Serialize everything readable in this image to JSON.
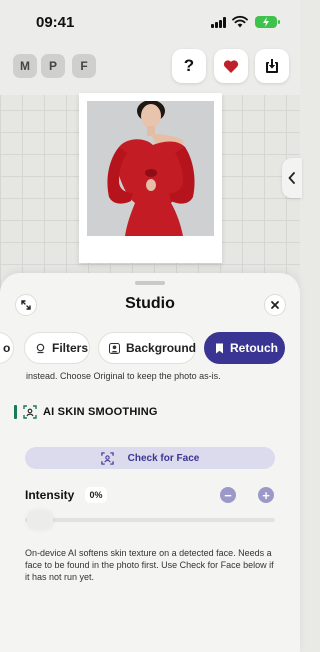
{
  "status_bar": {
    "time": "09:41"
  },
  "modes": [
    "M",
    "P",
    "F"
  ],
  "top_actions": {
    "help_label": "?"
  },
  "sheet": {
    "title": "Studio",
    "tabs": [
      {
        "label": "o",
        "icon": ""
      },
      {
        "label": "Filters",
        "icon": "filter-icon"
      },
      {
        "label": "Background",
        "icon": "person-icon"
      },
      {
        "label": "Retouch",
        "icon": "bookmark-icon",
        "active": true
      }
    ],
    "info_top": "instead. Choose Original to keep the photo as-is.",
    "section_title": "AI SKIN SMOOTHING",
    "check_face_label": "Check for Face",
    "intensity_label": "Intensity",
    "intensity_value": "0%",
    "minus_label": "−",
    "plus_label": "+",
    "info_bottom": "On-device AI softens skin texture on a detected face. Needs a face to be found in the photo first. Use Check for Face below if it has not run yet."
  },
  "colors": {
    "accent": "#3a3593",
    "accent_soft": "#dcdbee",
    "battery": "#3fc24b",
    "section_bar": "#1a7a55",
    "heart": "#c0202a"
  }
}
